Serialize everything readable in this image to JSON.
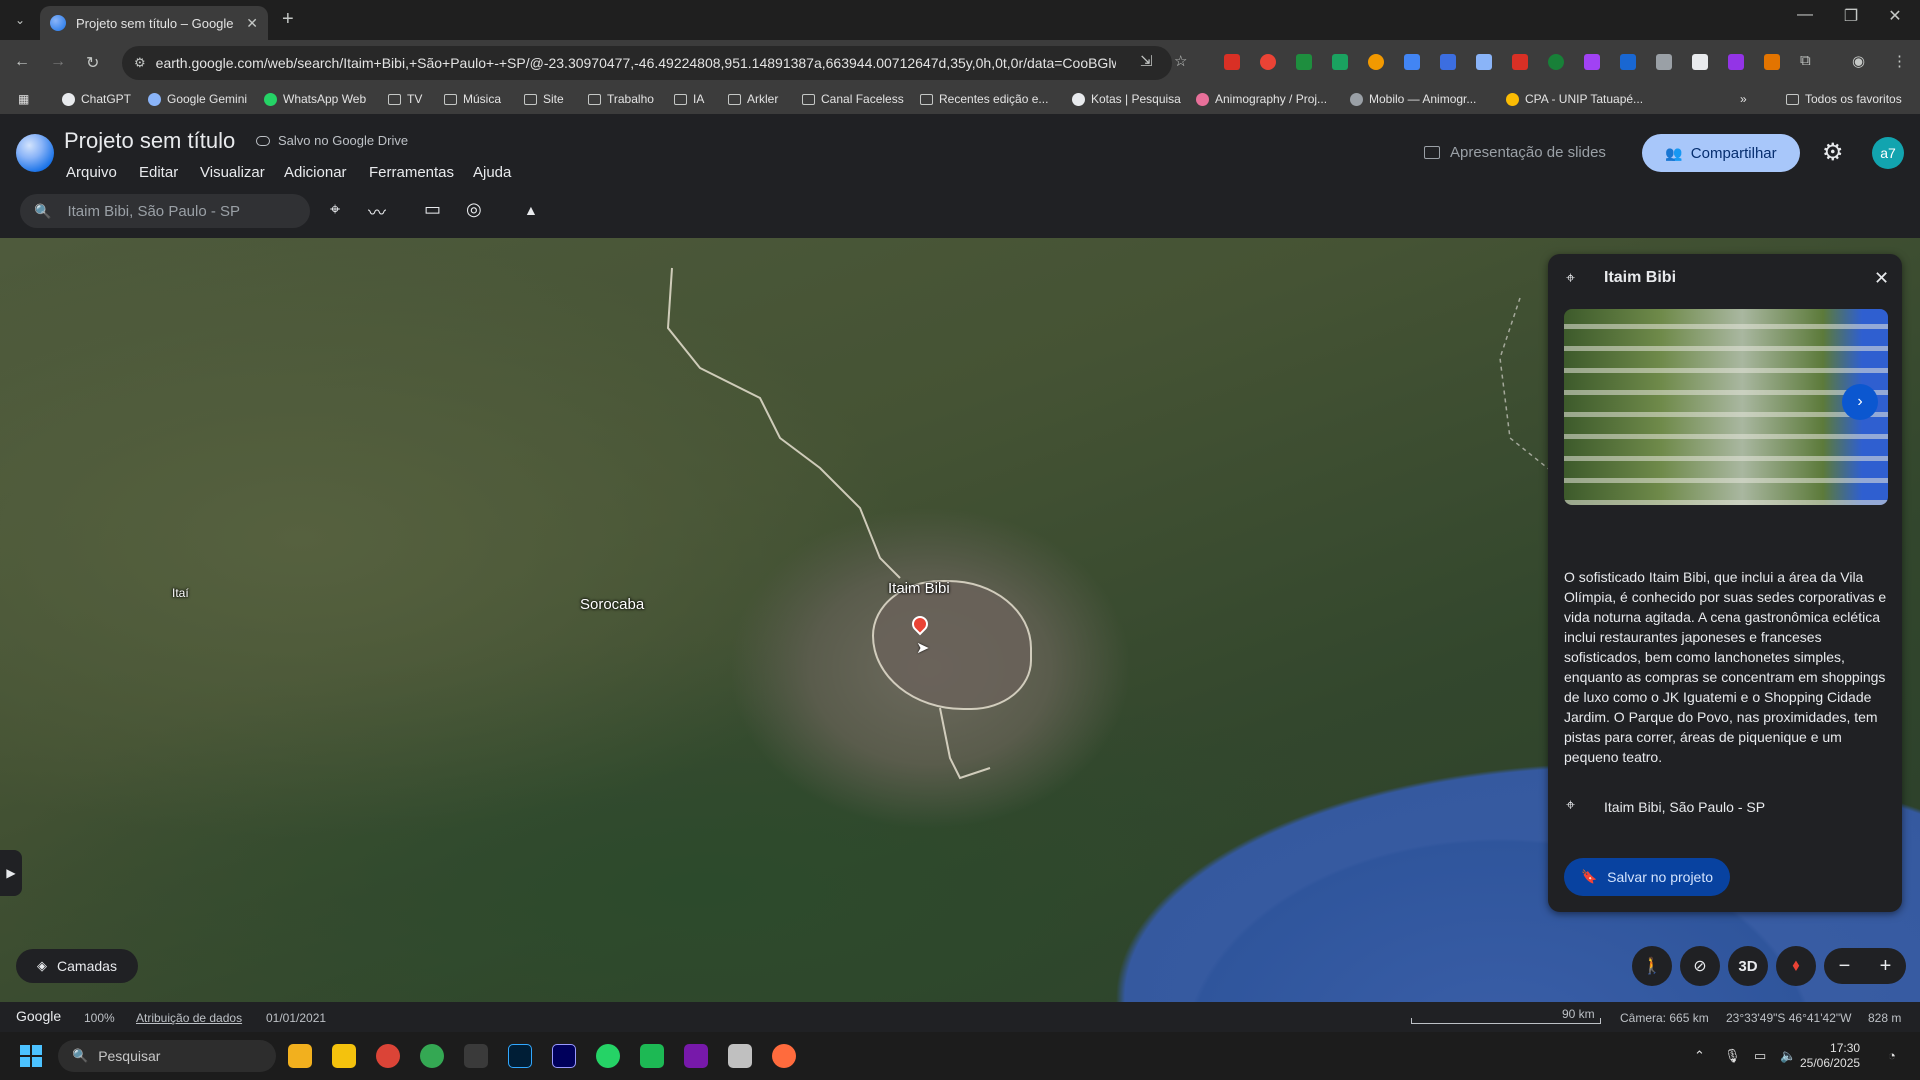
{
  "browser": {
    "tab_title": "Projeto sem título – Google Ear",
    "url": "earth.google.com/web/search/Itaim+Bibi,+São+Paulo+-+SP/@-23.30970477,-46.49224808,951.14891387a,663944.00712647d,35y,0h,0t,0r/data=CooBGlwS...",
    "bookmarks": [
      "ChatGPT",
      "Google Gemini",
      "WhatsApp Web",
      "TV",
      "Música",
      "Site",
      "Trabalho",
      "IA",
      "Arkler",
      "Canal Faceless",
      "Recentes edição e...",
      "Kotas | Pesquisa",
      "Animography / Proj...",
      "Mobilo — Animogr...",
      "CPA - UNIP Tatuapé..."
    ],
    "bookmarks_more": "»",
    "all_favorites": "Todos os favoritos"
  },
  "app": {
    "project_title": "Projeto sem título",
    "saved_status": "Salvo no Google Drive",
    "menu": [
      "Arquivo",
      "Editar",
      "Visualizar",
      "Adicionar",
      "Ferramentas",
      "Ajuda"
    ],
    "slideshow_label": "Apresentação de slides",
    "share_label": "Compartilhar",
    "avatar_initials": "a7",
    "search_value": "Itaim Bibi, São Paulo - SP"
  },
  "map": {
    "labels": {
      "itaim": "Itaim Bibi",
      "sorocaba": "Sorocaba",
      "itai": "Itaí"
    }
  },
  "panel": {
    "title": "Itaim Bibi",
    "description": "O sofisticado Itaim Bibi, que inclui a área da Vila Olímpia, é conhecido por suas sedes corporativas e vida noturna agitada. A cena gastronômica eclética inclui restaurantes japoneses e franceses sofisticados, bem como lanchonetes simples, enquanto as compras se concentram em shoppings de luxo como o JK Iguatemi e o Shopping Cidade Jardim. O Parque do Povo, nas proximidades, tem pistas para correr, áreas de piquenique e um pequeno teatro.",
    "address": "Itaim Bibi, São Paulo - SP",
    "save_button": "Salvar no projeto"
  },
  "controls": {
    "layers_label": "Camadas",
    "three_d_label": "3D"
  },
  "status": {
    "google": "Google",
    "zoom": "100%",
    "attribution": "Atribuição de dados",
    "date": "01/01/2021",
    "scale": "90 km",
    "camera": "Câmera: 665 km",
    "coords": "23°33'49\"S 46°41'42\"W",
    "elevation": "828 m"
  },
  "taskbar": {
    "search_placeholder": "Pesquisar",
    "time": "17:30",
    "date": "25/06/2025"
  },
  "colors": {
    "share_bg": "#a8c7fa",
    "save_btn_bg": "#0842a0",
    "accent_blue": "#1a73e8",
    "pin_red": "#ea4335"
  }
}
